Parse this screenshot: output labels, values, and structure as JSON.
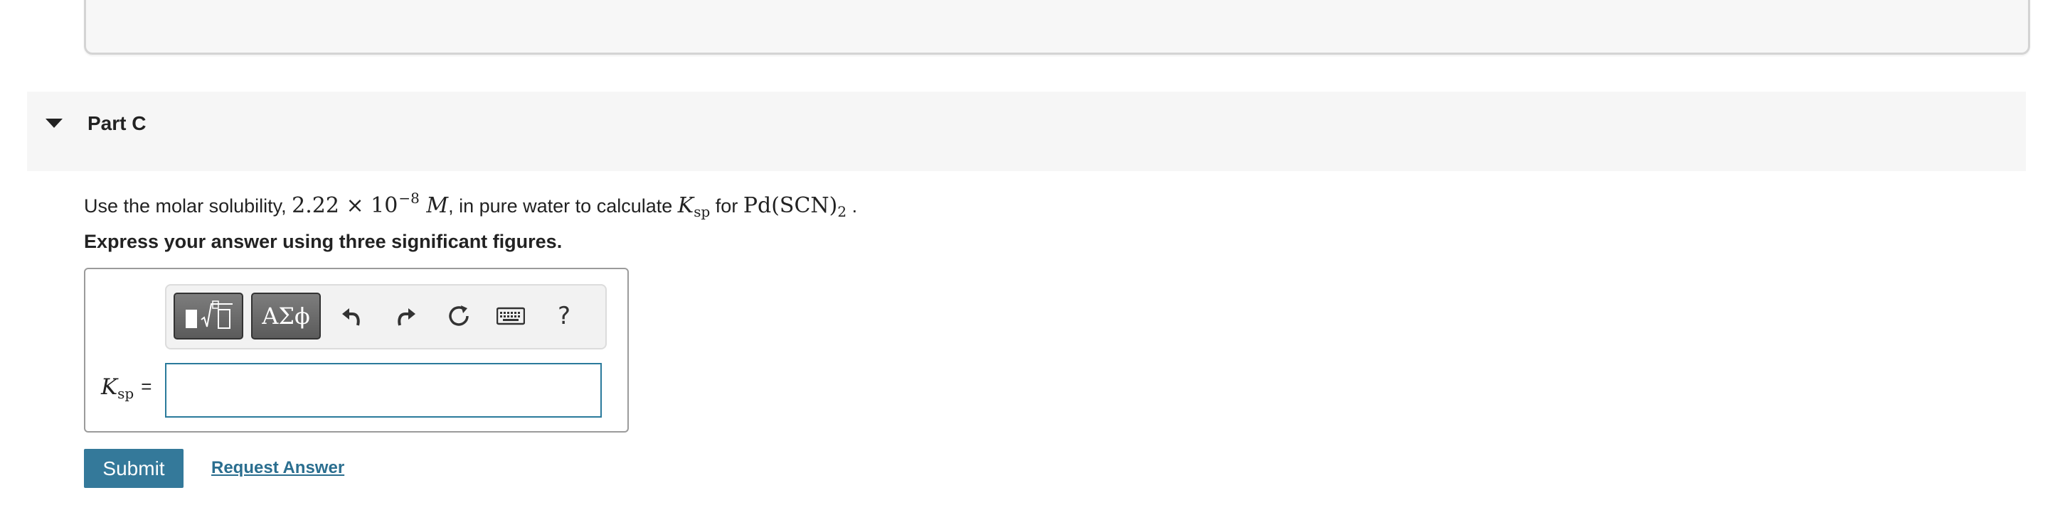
{
  "part": {
    "title": "Part C"
  },
  "question": {
    "prefix": "Use the molar solubility,",
    "coefficient": "2.22",
    "times": "×",
    "base": "10",
    "exponent": "−8",
    "unit": "M",
    "middle": ", in pure water to calculate",
    "ksp_symbol": "K",
    "ksp_sub": "sp",
    "for_text": "for",
    "compound_main": "Pd(SCN)",
    "compound_sub": "2",
    "end": "."
  },
  "instructions": "Express your answer using three significant figures.",
  "toolbar": {
    "greek_label": "ΑΣϕ",
    "help_label": "?",
    "icons": [
      "templates-icon",
      "undo-icon",
      "redo-icon",
      "reset-icon",
      "keyboard-icon",
      "help-icon"
    ]
  },
  "answer": {
    "label_symbol": "K",
    "label_sub": "sp",
    "equals": "=",
    "value": ""
  },
  "actions": {
    "submit_label": "Submit",
    "request_label": "Request Answer"
  },
  "colors": {
    "submit_bg": "#34799a",
    "link": "#2a6e8f",
    "input_border": "#2a7a9b"
  }
}
